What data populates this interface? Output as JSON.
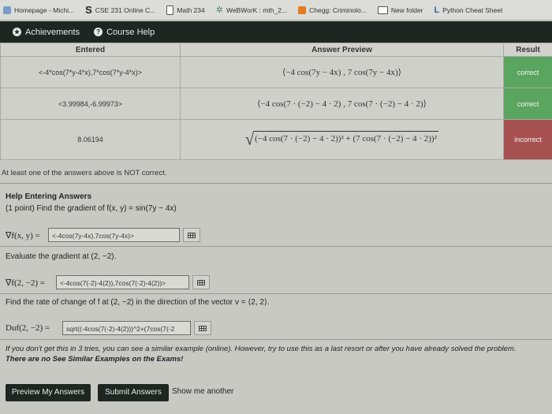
{
  "bookmarks": [
    {
      "icon": "favicon-icon",
      "label": "Homepage - Michi..."
    },
    {
      "icon": "s-logo-icon",
      "label": "CSE 231 Online C..."
    },
    {
      "icon": "document-icon",
      "label": "Math 234"
    },
    {
      "icon": "webwork-icon",
      "label": "WeBWorK : mth_2..."
    },
    {
      "icon": "chegg-icon",
      "label": "Chegg: Criminolo..."
    },
    {
      "icon": "folder-icon",
      "label": "New folder"
    },
    {
      "icon": "l-logo-icon",
      "label": "Python Cheat Sheet"
    }
  ],
  "nav": {
    "achievements": "Achievements",
    "course_help": "Course Help"
  },
  "results": {
    "headers": {
      "entered": "Entered",
      "preview": "Answer Preview",
      "result": "Result"
    },
    "rows": [
      {
        "entered": "<-4*cos(7*y-4*x),7*cos(7*y-4*x)>",
        "preview": "⟨−4 cos(7y − 4x) , 7 cos(7y − 4x)⟩",
        "result": "correct"
      },
      {
        "entered": "<3.99984,-6.99973>",
        "preview": "⟨−4 cos(7 · (−2) − 4 · 2) , 7 cos(7 · (−2) − 4 · 2)⟩",
        "result": "correct"
      },
      {
        "entered": "8.06194",
        "preview": "(−4 cos(7 · (−2) − 4 · 2))² + (7 cos(7 · (−2) − 4 · 2))²",
        "result": "incorrect"
      }
    ]
  },
  "warning": "At least one of the answers above is NOT correct.",
  "help": {
    "title": "Help Entering Answers",
    "problem": "(1 point) Find the gradient of f(x, y) = sin(7y − 4x)"
  },
  "parts": [
    {
      "label": "∇f(x, y) =",
      "value": "<-4cos(7y-4x),7cos(7y-4x)>"
    },
    {
      "instruction": "Evaluate the gradient at (2, −2).",
      "label": "∇f(2, −2) =",
      "value": "<-4cos(7(-2)-4(2)),7cos(7(-2)-4(2))>"
    },
    {
      "instruction": "Find the rate of change of f at (2, −2) in the direction of the vector v = ⟨2, 2⟩.",
      "label": "Duf(2, −2) =",
      "value": "sqrt((-4cos(7(-2)-4(2)))^2+(7cos(7(-2"
    }
  ],
  "note": {
    "line1": "If you don't get this in 3 tries, you can see a similar example (online). However, try to use this as a last resort or after you have already solved the problem.",
    "line2": "There are no See Similar Examples on the Exams!"
  },
  "buttons": {
    "preview": "Preview My Answers",
    "submit": "Submit Answers",
    "show_me": "Show me another"
  },
  "colors": {
    "navbar": "#1e2622",
    "correct": "#5aa560",
    "incorrect": "#a6514f"
  }
}
